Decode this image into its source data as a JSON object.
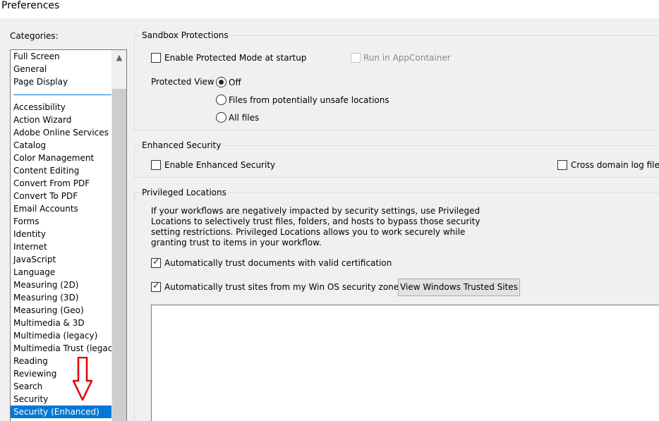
{
  "window": {
    "title": "Preferences"
  },
  "categories": {
    "label": "Categories:",
    "top_items": [
      "Full Screen",
      "General",
      "Page Display"
    ],
    "items": [
      "Accessibility",
      "Action Wizard",
      "Adobe Online Services",
      "Catalog",
      "Color Management",
      "Content Editing",
      "Convert From PDF",
      "Convert To PDF",
      "Email Accounts",
      "Forms",
      "Identity",
      "Internet",
      "JavaScript",
      "Language",
      "Measuring (2D)",
      "Measuring (3D)",
      "Measuring (Geo)",
      "Multimedia & 3D",
      "Multimedia (legacy)",
      "Multimedia Trust (legacy)",
      "Reading",
      "Reviewing",
      "Search",
      "Security",
      "Security (Enhanced)"
    ],
    "selected": "Security (Enhanced)",
    "scroll_up_icon": "▲"
  },
  "sandbox": {
    "title": "Sandbox Protections",
    "protected_mode_label": "Enable Protected Mode at startup",
    "protected_mode_checked": false,
    "appcontainer_label": "Run in AppContainer",
    "appcontainer_enabled": false,
    "protected_view_label": "Protected View",
    "protected_view_options": [
      "Off",
      "Files from potentially unsafe locations",
      "All files"
    ],
    "protected_view_selected": "Off"
  },
  "enhanced": {
    "title": "Enhanced Security",
    "enable_label": "Enable Enhanced Security",
    "enable_checked": false,
    "cross_domain_label": "Cross domain log file",
    "cross_domain_checked": false
  },
  "privileged": {
    "title": "Privileged Locations",
    "description": "If your workflows are negatively impacted by security settings, use Privileged Locations to selectively trust files, folders, and hosts to bypass those security setting restrictions. Privileged Locations allows you to work securely while granting trust to items in your workflow.",
    "trust_cert_label": "Automatically trust documents with valid certification",
    "trust_cert_checked": true,
    "trust_sites_label": "Automatically trust sites from my Win OS security zones",
    "trust_sites_checked": true,
    "view_sites_button": "View Windows Trusted Sites"
  },
  "annotation": {
    "arrow_color": "#e00000",
    "arrow_icon": "down-arrow-icon"
  }
}
